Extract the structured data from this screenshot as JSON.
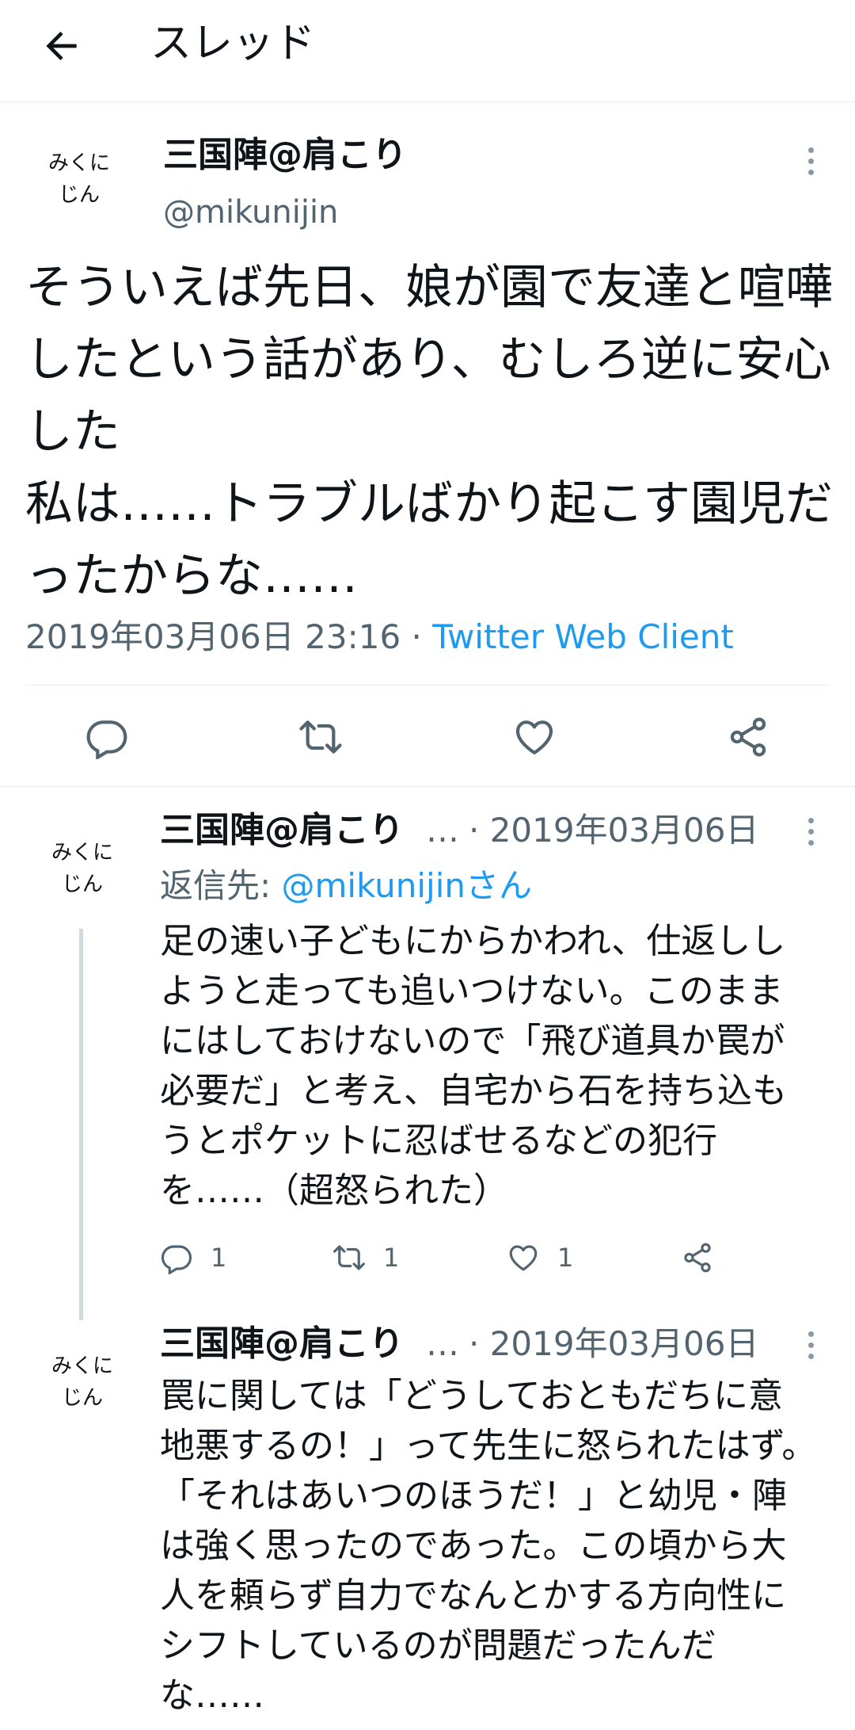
{
  "header": {
    "title": "スレッド"
  },
  "main_tweet": {
    "avatar_line1": "みくに",
    "avatar_line2": "じん",
    "author": "三国陣@肩こり",
    "handle": "@mikunijin",
    "text": "そういえば先日、娘が園で友達と喧嘩したという話があり、むしろ逆に安心した\n私は……トラブルばかり起こす園児だったからな……",
    "datetime": "2019年03月06日 23:16",
    "separator": " · ",
    "client": "Twitter Web Client"
  },
  "replies": [
    {
      "avatar_line1": "みくに",
      "avatar_line2": "じん",
      "author": "三国陣@肩こり",
      "ellipsis": "…",
      "date": "· 2019年03月06日",
      "reply_to_label": "返信先: ",
      "reply_to_handle": "@mikunijinさん",
      "text": "足の速い子どもにからかわれ、仕返ししようと走っても追いつけない。このままにはしておけないので「飛び道具か罠が必要だ」と考え、自宅から石を持ち込もうとポケットに忍ばせるなどの犯行を……（超怒られた）",
      "reply_count": "1",
      "retweet_count": "1",
      "like_count": "1"
    },
    {
      "avatar_line1": "みくに",
      "avatar_line2": "じん",
      "author": "三国陣@肩こり",
      "ellipsis": "…",
      "date": "· 2019年03月06日",
      "text": "罠に関しては「どうしておともだちに意地悪するの！」って先生に怒られたはず。「それはあいつのほうだ！」と幼児・陣は強く思ったのであった。この頃から大人を頼らず自力でなんとかする方向性にシフトしているのが問題だったんだな……"
    }
  ],
  "icons": [
    "back-arrow-icon",
    "reply-icon",
    "retweet-icon",
    "like-icon",
    "share-icon",
    "more-icon"
  ]
}
